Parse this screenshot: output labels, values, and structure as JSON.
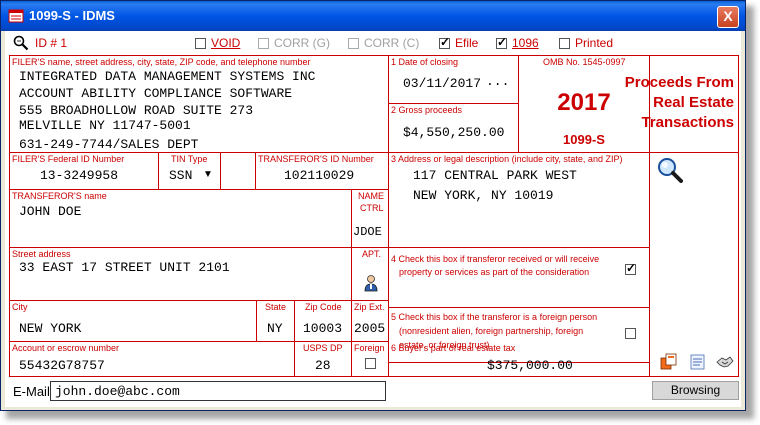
{
  "window": {
    "title": "1099-S - IDMS",
    "close": "X"
  },
  "toolbar": {
    "id_label": "ID # 1",
    "void": "VOID",
    "corr_g": "CORR (G)",
    "corr_c": "CORR (C)",
    "efile": "Efile",
    "form1096": "1096",
    "printed": "Printed",
    "void_checked": false,
    "efile_checked": true,
    "form1096_checked": true,
    "printed_checked": false
  },
  "filer": {
    "label": "FILER'S name, street address, city, state, ZIP code, and telephone number",
    "line1": "INTEGRATED DATA MANAGEMENT SYSTEMS INC",
    "line2": "ACCOUNT ABILITY COMPLIANCE SOFTWARE",
    "line3": "555 BROADHOLLOW ROAD SUITE 273",
    "line4": "MELVILLE NY 11747-5001",
    "phone": "631-249-7744/SALES DEPT"
  },
  "box1": {
    "label": "1 Date of closing",
    "value": "03/11/2017",
    "more": "..."
  },
  "box2": {
    "label": "2 Gross proceeds",
    "value": "$4,550,250.00"
  },
  "omb": {
    "number": "OMB No. 1545-0997",
    "year": "2017",
    "form": "1099-S"
  },
  "form_title": {
    "line1": "Proceeds From",
    "line2": "Real Estate",
    "line3": "Transactions"
  },
  "federal_id": {
    "label": "FILER'S Federal ID Number",
    "value": "13-3249958"
  },
  "tin_type": {
    "label": "TIN Type",
    "value": "SSN"
  },
  "transferor_id": {
    "label": "TRANSFEROR'S ID Number",
    "value": "102110029"
  },
  "box3": {
    "label": "3 Address or legal description (include city, state, and ZIP)",
    "line1": "117 CENTRAL PARK WEST",
    "line2": "NEW YORK, NY  10019"
  },
  "transferor_name": {
    "label": "TRANSFEROR'S name",
    "value": "JOHN DOE"
  },
  "name_ctrl": {
    "label1": "NAME",
    "label2": "CTRL",
    "value": "JDOE"
  },
  "street": {
    "label": "Street address",
    "value": "33 EAST 17 STREET UNIT 2101"
  },
  "apt": {
    "label": "APT."
  },
  "box4": {
    "label1": "4 Check this box if transferor received or will receive",
    "label2": "property or services as part of the consideration",
    "checked": true
  },
  "box5": {
    "label1": "5 Check this box if the transferor is a foreign person",
    "label2": "(nonresident alien, foreign partnership, foreign",
    "label3": "estate, or foreign trust)",
    "checked": false
  },
  "city": {
    "label": "City",
    "value": "NEW YORK"
  },
  "state": {
    "label": "State",
    "value": "NY"
  },
  "zip": {
    "label": "Zip Code",
    "value": "10003"
  },
  "zip_ext": {
    "label": "Zip Ext.",
    "value": "2005"
  },
  "account": {
    "label": "Account or escrow number",
    "value": "55432G78757"
  },
  "usps": {
    "label": "USPS DP",
    "value": "28"
  },
  "foreign": {
    "label": "Foreign"
  },
  "box6": {
    "label": "6 Buyer's part of real estate tax",
    "value": "$375,000.00"
  },
  "email": {
    "label": "E-Mail:",
    "value": "john.doe@abc.com"
  },
  "browse": {
    "label": "Browsing"
  }
}
